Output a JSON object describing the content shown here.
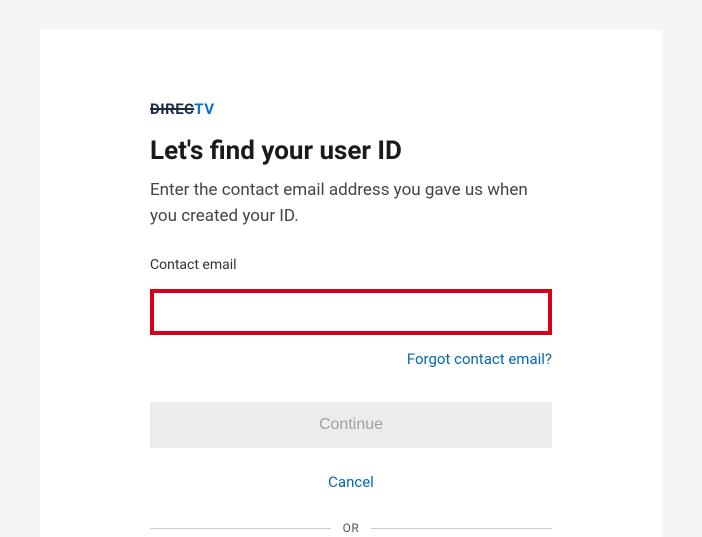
{
  "logo": {
    "part1": "DIREC",
    "part2": "TV"
  },
  "header": {
    "title": "Let's find your user ID",
    "subtitle": "Enter the contact email address you gave us when you created your ID."
  },
  "form": {
    "email_label": "Contact email",
    "email_value": "",
    "forgot_link": "Forgot contact email?",
    "continue_label": "Continue",
    "cancel_label": "Cancel"
  },
  "divider": {
    "text": "OR"
  }
}
